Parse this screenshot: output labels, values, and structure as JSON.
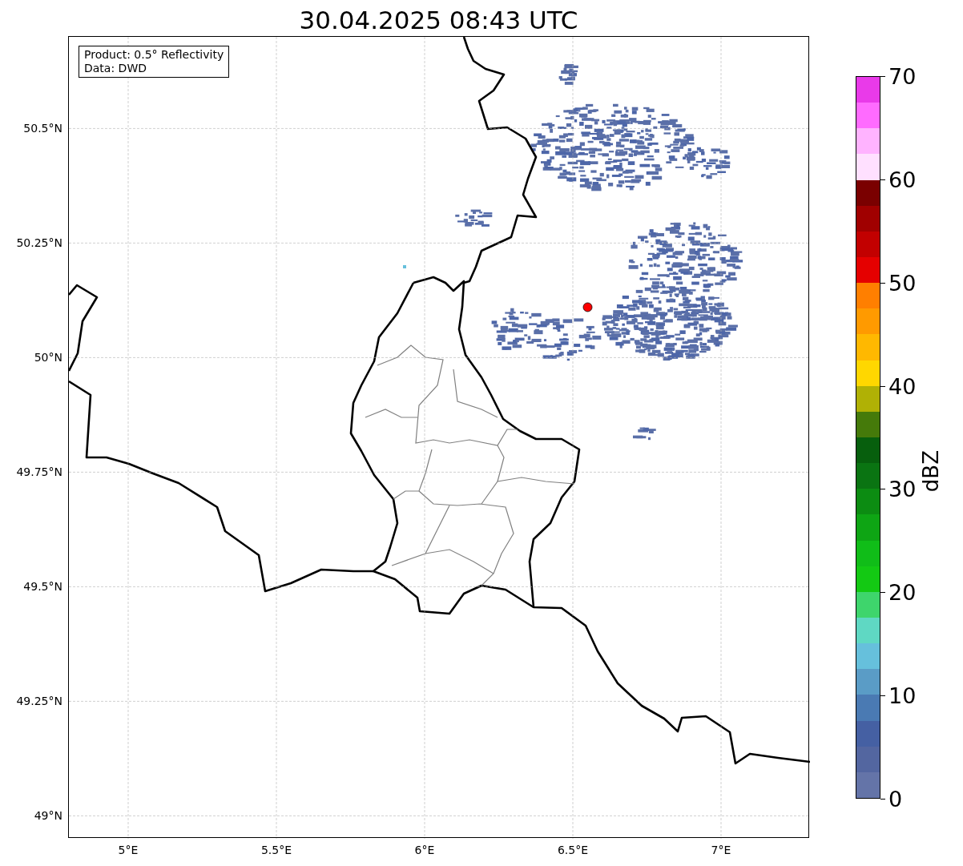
{
  "map": {
    "legend": [
      "Product: 0.5° Reflectivity",
      "Data: DWD"
    ],
    "chart_data": {
      "type": "scatter",
      "grid": true,
      "title": "30.04.2025 08:43 UTC",
      "xlim": [
        4.8,
        7.3
      ],
      "ylim": [
        48.95,
        50.7
      ],
      "xticks": [
        {
          "value": 5,
          "label": "5°E"
        },
        {
          "value": 5.5,
          "label": "5.5°E"
        },
        {
          "value": 6,
          "label": "6°E"
        },
        {
          "value": 6.5,
          "label": "6.5°E"
        },
        {
          "value": 7,
          "label": "7°E"
        }
      ],
      "yticks": [
        {
          "value": 49,
          "label": "49°N"
        },
        {
          "value": 49.25,
          "label": "49.25°N"
        },
        {
          "value": 49.5,
          "label": "49.5°N"
        },
        {
          "value": 49.75,
          "label": "49.75°N"
        },
        {
          "value": 50,
          "label": "50°N"
        },
        {
          "value": 50.25,
          "label": "50.25°N"
        },
        {
          "value": 50.5,
          "label": "50.5°N"
        }
      ],
      "x": [
        6.55
      ],
      "series": [
        {
          "color": "#ff0000",
          "values": [
            50.11
          ]
        }
      ]
    }
  },
  "colorbar": {
    "label": "dBZ",
    "ticks": [
      "70",
      "60",
      "50",
      "40",
      "30",
      "20",
      "10",
      "0"
    ],
    "bins": [
      {
        "color": "#e93ae9"
      },
      {
        "color": "#ff6bff"
      },
      {
        "color": "#ffb3ff"
      },
      {
        "color": "#ffe0ff"
      },
      {
        "color": "#7a0000"
      },
      {
        "color": "#a00000"
      },
      {
        "color": "#c20000"
      },
      {
        "color": "#e50000"
      },
      {
        "color": "#ff7f00"
      },
      {
        "color": "#ff9a00"
      },
      {
        "color": "#ffb800"
      },
      {
        "color": "#ffd700"
      },
      {
        "color": "#b0b105"
      },
      {
        "color": "#457a0a"
      },
      {
        "color": "#075f0d"
      },
      {
        "color": "#0a7412"
      },
      {
        "color": "#0c8c12"
      },
      {
        "color": "#0ea514"
      },
      {
        "color": "#10bd18"
      },
      {
        "color": "#13c913"
      },
      {
        "color": "#3ed56c"
      },
      {
        "color": "#5fd8c3"
      },
      {
        "color": "#66c0dc"
      },
      {
        "color": "#5a9cc6"
      },
      {
        "color": "#4a7ab3"
      },
      {
        "color": "#4560a3"
      },
      {
        "color": "#5366a0"
      },
      {
        "color": "#6474a8"
      }
    ]
  }
}
